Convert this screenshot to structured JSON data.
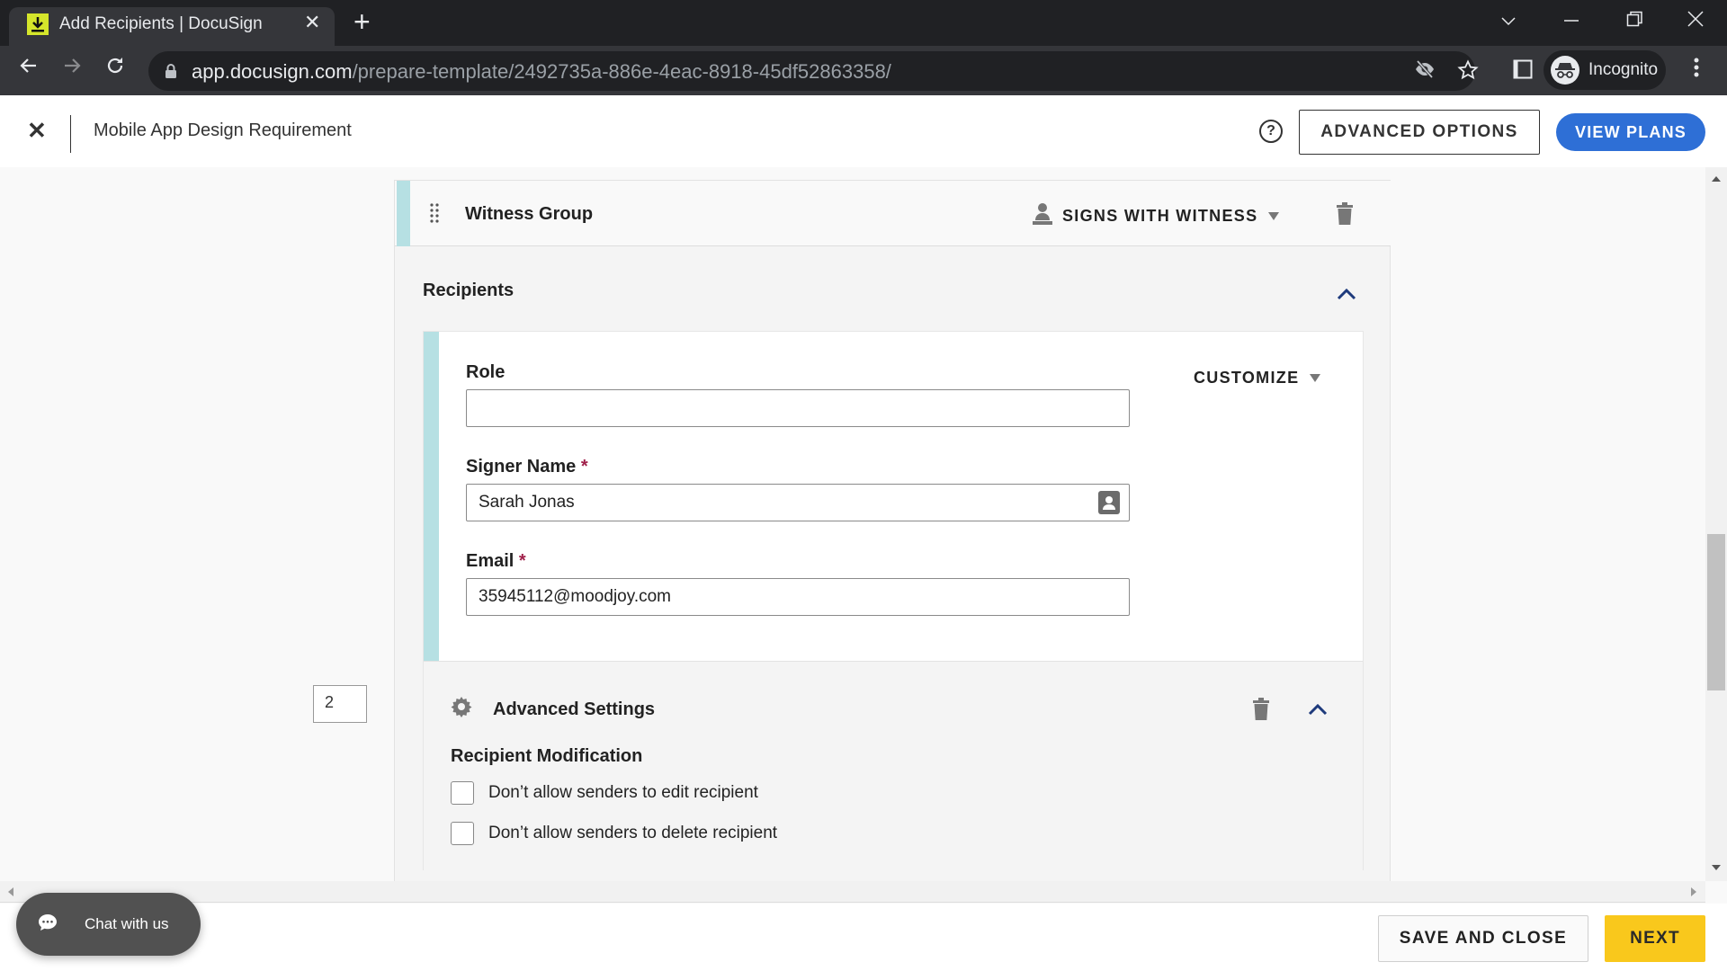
{
  "browser": {
    "tab_title": "Add Recipients | DocuSign",
    "url_domain": "app.docusign.com",
    "url_path": "/prepare-template/2492735a-886e-4eac-8918-45df52863358/",
    "profile_label": "Incognito"
  },
  "header": {
    "document_title": "Mobile App Design Requirement",
    "advanced_options_label": "ADVANCED OPTIONS",
    "view_plans_label": "VIEW PLANS"
  },
  "page_indicator": "2",
  "group": {
    "title": "Witness Group",
    "signing_type": "SIGNS WITH WITNESS"
  },
  "recipients": {
    "section_title": "Recipients",
    "customize_label": "CUSTOMIZE",
    "role": {
      "label": "Role",
      "value": ""
    },
    "signer_name": {
      "label": "Signer Name",
      "required_mark": "*",
      "value": "Sarah Jonas"
    },
    "email": {
      "label": "Email",
      "required_mark": "*",
      "value": "35945112@moodjoy.com"
    }
  },
  "advanced_settings": {
    "title": "Advanced Settings",
    "modification_title": "Recipient Modification",
    "options": [
      {
        "label": "Don’t allow senders to edit recipient",
        "checked": false
      },
      {
        "label": "Don’t allow senders to delete recipient",
        "checked": false
      }
    ]
  },
  "footer": {
    "chat_label": "Chat with us",
    "save_close_label": "SAVE AND CLOSE",
    "next_label": "NEXT"
  },
  "colors": {
    "accent_teal": "#b6e0e3",
    "primary_blue": "#2e6fd6",
    "next_yellow": "#f9c81c",
    "required_red": "#a0204a"
  }
}
